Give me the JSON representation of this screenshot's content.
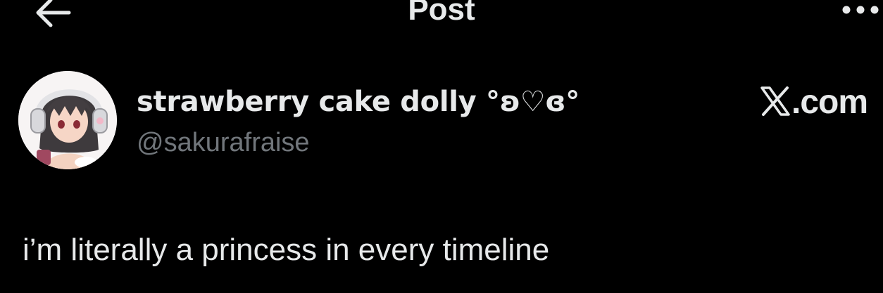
{
  "header": {
    "title": "Post",
    "back_icon": "arrow-left-icon",
    "more_icon": "more-horizontal-icon"
  },
  "author": {
    "display_name": "strawberry cake dolly °ʚ♡ɞ°",
    "handle": "@sakurafraise",
    "avatar": "anime-girl-avatar"
  },
  "watermark": {
    "text": ".com",
    "icon": "x-logo-icon"
  },
  "post": {
    "text": "i’m literally a princess in every timeline"
  },
  "colors": {
    "background": "#000000",
    "primary_text": "#e7e9ea",
    "secondary_text": "#71767b"
  }
}
